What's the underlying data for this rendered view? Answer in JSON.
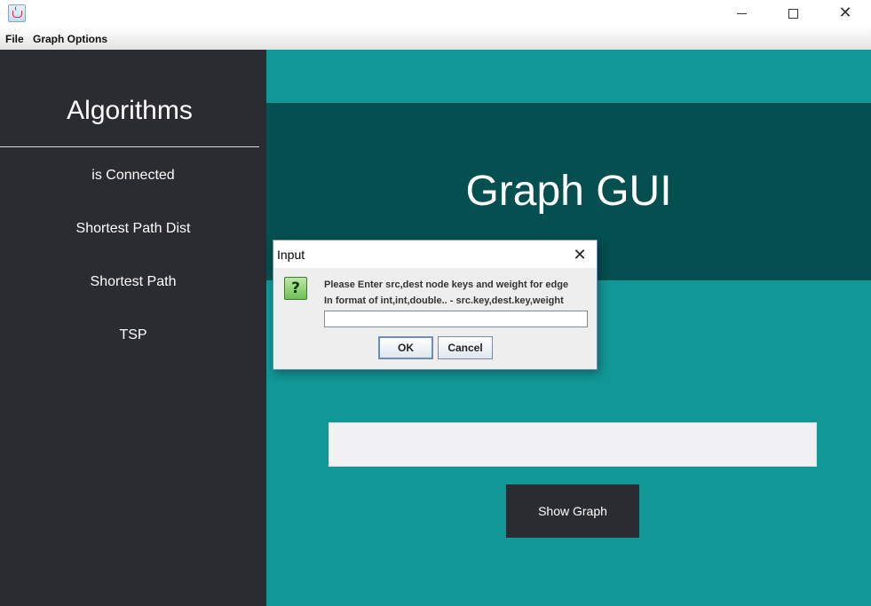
{
  "window": {
    "icon": "java-cup-icon",
    "controls": [
      "minimize-icon",
      "maximize-icon",
      "close-icon"
    ]
  },
  "menubar": {
    "items": [
      "File",
      "Graph Options"
    ]
  },
  "sidebar": {
    "title": "Algorithms",
    "items": [
      "is Connected",
      "Shortest Path Dist",
      "Shortest Path",
      "TSP"
    ]
  },
  "main": {
    "banner_title": "Graph GUI",
    "input_value": "",
    "show_graph_label": "Show Graph"
  },
  "dialog": {
    "title": "Input",
    "icon": "question-icon",
    "icon_glyph": "?",
    "message_line1": "Please Enter src,dest node keys and weight for edge",
    "message_line2": "In format of int,int,double.. - src.key,dest.key,weight",
    "input_value": "",
    "ok_label": "OK",
    "cancel_label": "Cancel"
  },
  "colors": {
    "sidebar_bg": "#2b2c32",
    "main_bg": "#129797",
    "banner_bg": "#044f4f",
    "button_bg": "#2b2c32"
  }
}
